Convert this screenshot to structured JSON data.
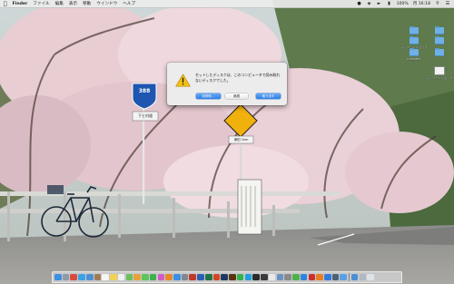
{
  "menubar": {
    "apple_icon": "apple-logo-icon",
    "app_name": "Finder",
    "menus": [
      "ファイル",
      "編集",
      "表示",
      "移動",
      "ウインドウ",
      "ヘルプ"
    ],
    "battery": "100%",
    "clock": "月 16:18"
  },
  "desktop_icons": [
    {
      "kind": "folder",
      "label": ""
    },
    {
      "kind": "folder",
      "label": ""
    },
    {
      "kind": "folder",
      "label": "スクリーンショット"
    },
    {
      "kind": "folder",
      "label": ""
    },
    {
      "kind": "folder",
      "label": "Illustrator"
    },
    {
      "kind": "folder",
      "label": ""
    },
    {
      "kind": "file",
      "label": "スクリーンショット"
    }
  ],
  "dialog": {
    "icon": "warning-triangle-icon",
    "message": "セットしたディスクは、このコンピュータで読み取れないディスクでした。",
    "buttons": {
      "initialize": "初期化...",
      "ignore": "無視",
      "eject": "取り出す"
    }
  },
  "scene": {
    "route_sign": "388",
    "place_sign": "下ヒ村道",
    "distance_sign": "津田 1km"
  },
  "colors": {
    "accent": "#2f7ee6",
    "warning": "#f4c012",
    "blossom": "#f0d6de"
  },
  "dock": {
    "apps": [
      {
        "name": "finder-icon",
        "color": "#3d8fe0"
      },
      {
        "name": "launchpad-icon",
        "color": "#8e9aa8"
      },
      {
        "name": "chrome-icon",
        "color": "#d94b3c"
      },
      {
        "name": "safari-icon",
        "color": "#3aa3e8"
      },
      {
        "name": "mail-icon",
        "color": "#4e8fd4"
      },
      {
        "name": "contacts-icon",
        "color": "#a07b52"
      },
      {
        "name": "calendar-icon",
        "color": "#f5f5f5"
      },
      {
        "name": "notes-icon",
        "color": "#f2d250"
      },
      {
        "name": "reminders-icon",
        "color": "#f1f1f1"
      },
      {
        "name": "maps-icon",
        "color": "#6cbf5d"
      },
      {
        "name": "photos-icon",
        "color": "#e8a23b"
      },
      {
        "name": "messages-icon",
        "color": "#5cc45a"
      },
      {
        "name": "facetime-icon",
        "color": "#3fb04b"
      },
      {
        "name": "itunes-icon",
        "color": "#d35bc5"
      },
      {
        "name": "ibooks-icon",
        "color": "#e48a2b"
      },
      {
        "name": "appstore-icon",
        "color": "#3a8fe6"
      },
      {
        "name": "preferences-icon",
        "color": "#7f8790"
      },
      {
        "name": "filezilla-icon",
        "color": "#c0392b"
      },
      {
        "name": "word-icon",
        "color": "#2b5fb4"
      },
      {
        "name": "excel-icon",
        "color": "#217346"
      },
      {
        "name": "powerpoint-icon",
        "color": "#d24726"
      },
      {
        "name": "photoshop-icon",
        "color": "#1e3a5f"
      },
      {
        "name": "illustrator-icon",
        "color": "#5a3410"
      },
      {
        "name": "line-icon",
        "color": "#33b34a"
      },
      {
        "name": "skype-icon",
        "color": "#1ea0e0"
      },
      {
        "name": "terminal-icon",
        "color": "#2b2b2b"
      },
      {
        "name": "activity-monitor-icon",
        "color": "#3b3b3b"
      },
      {
        "name": "textedit-icon",
        "color": "#e9e9e9"
      },
      {
        "name": "preview-icon",
        "color": "#6b91c4"
      },
      {
        "name": "font-book-icon",
        "color": "#8a8a8a"
      },
      {
        "name": "evernote-icon",
        "color": "#4fb04a"
      },
      {
        "name": "dropbox-icon",
        "color": "#2f83e0"
      },
      {
        "name": "acrobat-icon",
        "color": "#c9302c"
      },
      {
        "name": "vlc-icon",
        "color": "#e67e22"
      },
      {
        "name": "xcode-icon",
        "color": "#2f7be0"
      },
      {
        "name": "time-machine-icon",
        "color": "#4f6272"
      },
      {
        "name": "finder-window-icon",
        "color": "#5aa0e8"
      }
    ],
    "downloads_icon": "downloads-stack-icon",
    "documents_icon": "documents-stack-icon",
    "trash_icon": "trash-icon"
  }
}
